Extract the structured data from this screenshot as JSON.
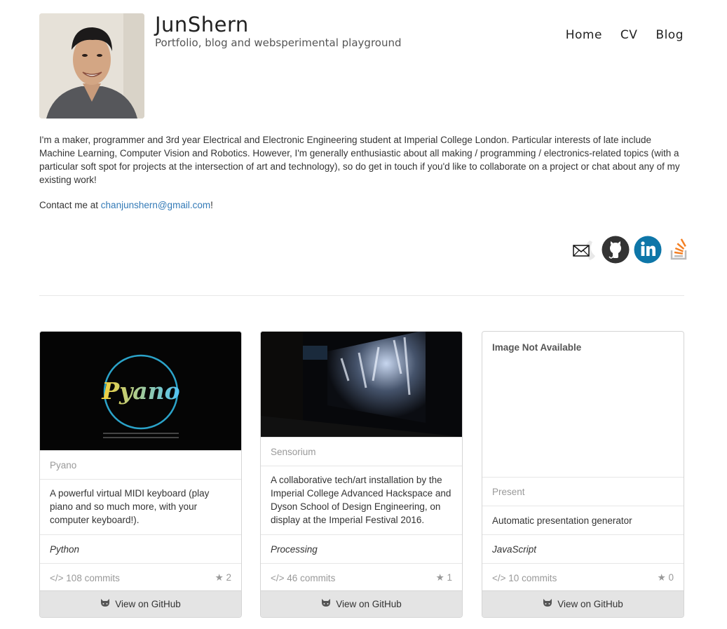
{
  "header": {
    "title": "JunShern",
    "tagline": "Portfolio, blog and websperimental playground"
  },
  "nav": [
    "Home",
    "CV",
    "Blog"
  ],
  "bio": "I'm a maker, programmer and 3rd year Electrical and Electronic Engineering student at Imperial College London. Particular interests of late include Machine Learning, Computer Vision and Robotics. However, I'm generally enthusiastic about all making / programming / electronics-related topics (with a particular soft spot for projects at the intersection of art and technology), so do get in touch if you'd like to collaborate on a project or chat about any of my existing work!",
  "contact": {
    "prefix": "Contact me at ",
    "email": "chanjunshern@gmail.com",
    "suffix": "!"
  },
  "social": [
    "email-icon",
    "github-icon",
    "linkedin-icon",
    "stackoverflow-icon"
  ],
  "projects": [
    {
      "name": "Pyano",
      "image_text": "Pyano",
      "description": "A powerful virtual MIDI keyboard (play piano and so much more, with your computer keyboard!).",
      "language": "Python",
      "commits": "108 commits",
      "stars": "2",
      "button": "View on GitHub"
    },
    {
      "name": "Sensorium",
      "description": "A collaborative tech/art installation by the Imperial College Advanced Hackspace and Dyson School of Design Engineering, on display at the Imperial Festival 2016.",
      "language": "Processing",
      "commits": "46 commits",
      "stars": "1",
      "button": "View on GitHub"
    },
    {
      "name": "Present",
      "image_placeholder": "Image Not Available",
      "description": "Automatic presentation generator",
      "language": "JavaScript",
      "commits": "10 commits",
      "stars": "0",
      "button": "View on GitHub"
    }
  ],
  "colors": {
    "link": "#337ab7",
    "linkedin": "#0e76a8",
    "github": "#333333",
    "stackoverflow": "#f48024",
    "button_bg": "#e4e4e4"
  }
}
